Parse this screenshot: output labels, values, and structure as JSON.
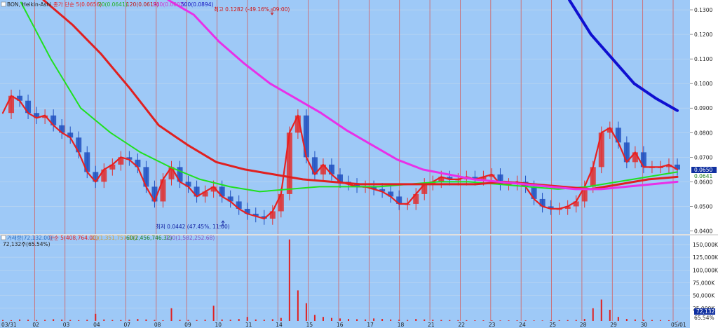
{
  "colors": {
    "background": "#9ec9f7",
    "price_axis_bg": "#ffffff",
    "separator": "#d46060",
    "grid_h": "#c0d8ee",
    "ma5": "#e82020",
    "ma20": "#20e020",
    "ma120": "#e02020",
    "ma240": "#e830e8",
    "ma500": "#1010d0",
    "candle_up": "#e03030",
    "candle_down": "#2050c0"
  },
  "price_legend": {
    "symbol": "BON, Heikin-Ashi",
    "ma5": "종가 단순 5(0.0656)",
    "ma20": "20(0.0641)",
    "ma120": "120(0.0619)",
    "ma240": "240(0.0602)",
    "ma500": "500(0.0894)"
  },
  "volume_legend": {
    "main": "거래량(72,132.00)",
    "ma5": "단순 5(408,764.00)",
    "ma20": "20(1,351,757.30)",
    "ma60": "60(2,456,746.32)",
    "ma120": "120(1,582,252.68)",
    "sub": "72,132주(65.54%)"
  },
  "annotations": {
    "high": "최고 0.1282 (-49.16%, 09:00)",
    "low": "최저 0.0442 (47.45%, 11:00)"
  },
  "current_price_label": "0.0650",
  "current_price_sub": "0.0641",
  "current_volume_label": "72,132",
  "current_volume_pct": "65.54%",
  "chart_data": {
    "type": "line",
    "candle_type": "Heikin-Ashi",
    "date_ticks": [
      "03/31",
      "02",
      "03",
      "04",
      "07",
      "08",
      "09",
      "10",
      "11",
      "14",
      "15",
      "16",
      "17",
      "18",
      "21",
      "22",
      "23",
      "24",
      "25",
      "28",
      "29",
      "30",
      "05/01"
    ],
    "price_axis": {
      "ylim": [
        0.039,
        0.134
      ],
      "ticks": [
        "0.1300",
        "0.1200",
        "0.1100",
        "0.1000",
        "0.0900",
        "0.0800",
        "0.0700",
        "0.0600",
        "0.0500",
        "0.0400"
      ]
    },
    "volume_axis": {
      "ylim": [
        0,
        165000
      ],
      "ticks": [
        "150,000K",
        "125,000K",
        "100,000K",
        "75,000K",
        "50,000K",
        "25,000K"
      ]
    },
    "series": [
      {
        "name": "5",
        "values": [
          0.088,
          0.095,
          0.093,
          0.088,
          0.086,
          0.087,
          0.083,
          0.08,
          0.078,
          0.072,
          0.064,
          0.06,
          0.065,
          0.067,
          0.07,
          0.069,
          0.066,
          0.058,
          0.052,
          0.061,
          0.066,
          0.06,
          0.058,
          0.054,
          0.056,
          0.058,
          0.054,
          0.052,
          0.049,
          0.047,
          0.046,
          0.045,
          0.048,
          0.055,
          0.08,
          0.087,
          0.07,
          0.063,
          0.067,
          0.063,
          0.06,
          0.059,
          0.058,
          0.058,
          0.057,
          0.056,
          0.054,
          0.051,
          0.051,
          0.055,
          0.059,
          0.06,
          0.062,
          0.061,
          0.061,
          0.062,
          0.061,
          0.062,
          0.063,
          0.059,
          0.059,
          0.06,
          0.058,
          0.053,
          0.05,
          0.049,
          0.049,
          0.05,
          0.052,
          0.058,
          0.066,
          0.08,
          0.082,
          0.076,
          0.068,
          0.072,
          0.066,
          0.066,
          0.066,
          0.067,
          0.065
        ]
      },
      {
        "name": "20",
        "values": [
          0.133,
          0.11,
          0.09,
          0.08,
          0.072,
          0.066,
          0.061,
          0.058,
          0.056,
          0.057,
          0.058,
          0.058,
          0.058,
          0.059,
          0.06,
          0.06,
          0.059,
          0.058,
          0.057,
          0.058,
          0.06,
          0.062,
          0.064
        ]
      },
      {
        "name": "120",
        "values": [
          0.134,
          0.124,
          0.112,
          0.098,
          0.083,
          0.075,
          0.068,
          0.065,
          0.063,
          0.061,
          0.06,
          0.059,
          0.059,
          0.059,
          0.059,
          0.059,
          0.06,
          0.059,
          0.058,
          0.057,
          0.059,
          0.061,
          0.062
        ]
      },
      {
        "name": "240",
        "values": [
          0.134,
          0.128,
          0.117,
          0.108,
          0.1,
          0.094,
          0.088,
          0.081,
          0.075,
          0.069,
          0.065,
          0.063,
          0.061,
          0.06,
          0.059,
          0.058,
          0.057,
          0.057,
          0.058,
          0.059,
          0.06
        ]
      },
      {
        "name": "500",
        "values": [
          0.134,
          0.12,
          0.11,
          0.1,
          0.094,
          0.089
        ]
      }
    ],
    "volume_values": [
      2000,
      1500,
      3000,
      2500,
      1800,
      2200,
      3500,
      2800,
      2000,
      1600,
      2400,
      14000,
      3000,
      2000,
      1800,
      2500,
      4000,
      3000,
      2000,
      1500,
      25000,
      2200,
      2000,
      1800,
      2500,
      30000,
      3000,
      2500,
      4000,
      8000,
      3000,
      2500,
      3500,
      6000,
      160000,
      60000,
      35000,
      12000,
      8000,
      6000,
      5000,
      4000,
      3500,
      3000,
      5000,
      4000,
      3000,
      2500,
      2000,
      4000,
      3000,
      2500,
      2000,
      1800,
      1600,
      1500,
      1400,
      1300,
      1200,
      1100,
      1200,
      1300,
      1200,
      1100,
      1000,
      1200,
      1500,
      1800,
      2000,
      4000,
      25000,
      42000,
      22000,
      8000,
      4000,
      3000,
      2500,
      2000,
      1800,
      1500,
      72
    ]
  }
}
